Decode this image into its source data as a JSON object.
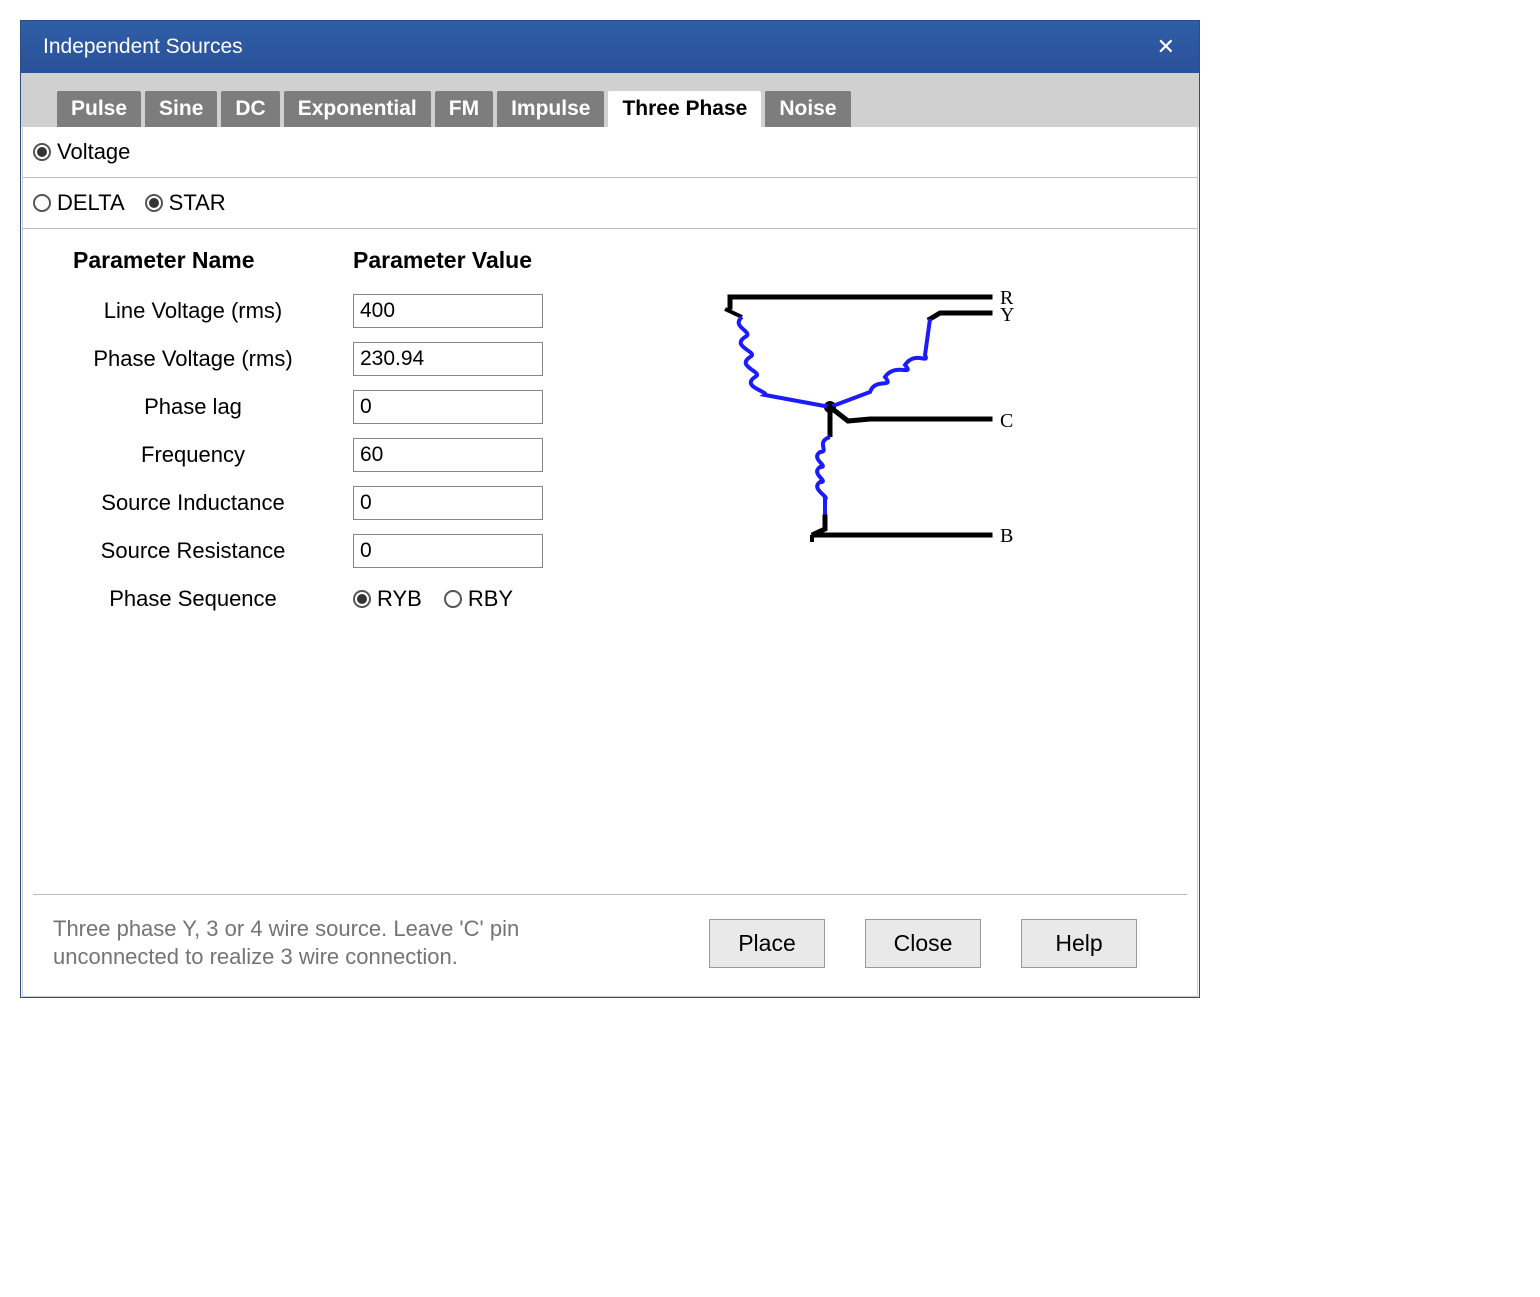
{
  "window": {
    "title": "Independent Sources"
  },
  "tabs": [
    {
      "label": "Pulse",
      "active": false
    },
    {
      "label": "Sine",
      "active": false
    },
    {
      "label": "DC",
      "active": false
    },
    {
      "label": "Exponential",
      "active": false
    },
    {
      "label": "FM",
      "active": false
    },
    {
      "label": "Impulse",
      "active": false
    },
    {
      "label": "Three Phase",
      "active": true
    },
    {
      "label": "Noise",
      "active": false
    }
  ],
  "source_type": {
    "voltage_label": "Voltage",
    "voltage_checked": true
  },
  "topology": {
    "delta_label": "DELTA",
    "delta_checked": false,
    "star_label": "STAR",
    "star_checked": true
  },
  "table": {
    "header_name": "Parameter Name",
    "header_value": "Parameter Value",
    "rows": [
      {
        "name": "Line Voltage (rms)",
        "value": "400"
      },
      {
        "name": "Phase Voltage (rms)",
        "value": "230.94"
      },
      {
        "name": "Phase lag",
        "value": "0"
      },
      {
        "name": "Frequency",
        "value": "60"
      },
      {
        "name": "Source Inductance",
        "value": "0"
      },
      {
        "name": "Source Resistance",
        "value": "0"
      }
    ],
    "phase_sequence_label": "Phase Sequence",
    "phase_sequence": {
      "ryb_label": "RYB",
      "ryb_checked": true,
      "rby_label": "RBY",
      "rby_checked": false
    }
  },
  "diagram": {
    "labels": {
      "r": "R",
      "y": "Y",
      "c": "C",
      "b": "B"
    }
  },
  "footer": {
    "help_text": "Three phase Y, 3 or 4 wire source. Leave 'C' pin unconnected to realize 3 wire connection.",
    "place": "Place",
    "close": "Close",
    "help": "Help"
  }
}
